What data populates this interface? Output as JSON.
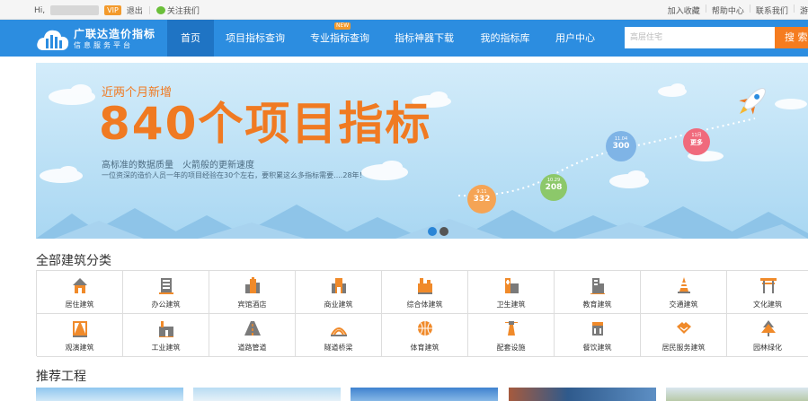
{
  "topbar": {
    "greeting": "Hi,",
    "vip_badge": "VIP",
    "logout": "退出",
    "follow": "关注我们",
    "links": [
      "加入收藏",
      "帮助中心",
      "联系我们",
      "游"
    ]
  },
  "nav": {
    "logo_title": "广联达造价指标",
    "logo_sub": "信息服务平台",
    "items": [
      "首页",
      "项目指标查询",
      "专业指标查询",
      "指标神器下载",
      "我的指标库",
      "用户中心"
    ],
    "new_badge": "NEW",
    "search_placeholder": "高层住宅",
    "search_button": "搜 索"
  },
  "banner": {
    "subtitle": "近两个月新增",
    "headline": "840个项目指标",
    "line1": "高标准的数据质量　火箭般的更新速度",
    "line2": "一位资深的造价人员一年的项目经验在30个左右，要积累这么多指标需要....28年！",
    "bubbles": [
      {
        "date": "9.11",
        "value": "332",
        "color": "#f5a455"
      },
      {
        "date": "10.29",
        "value": "208",
        "color": "#8cc86a"
      },
      {
        "date": "11.04",
        "value": "300",
        "color": "#7fb4e6"
      },
      {
        "date": "11月",
        "value": "更多",
        "color": "#f06a7c"
      }
    ],
    "dots": [
      "#2a85d6",
      "#555555"
    ]
  },
  "categories": {
    "title": "全部建筑分类",
    "items": [
      {
        "label": "居住建筑",
        "icon": "house-icon"
      },
      {
        "label": "办公建筑",
        "icon": "office-building-icon"
      },
      {
        "label": "宾馆酒店",
        "icon": "hotel-icon"
      },
      {
        "label": "商业建筑",
        "icon": "commercial-building-icon"
      },
      {
        "label": "综合体建筑",
        "icon": "complex-building-icon"
      },
      {
        "label": "卫生建筑",
        "icon": "hospital-icon"
      },
      {
        "label": "教育建筑",
        "icon": "school-icon"
      },
      {
        "label": "交通建筑",
        "icon": "traffic-cone-icon"
      },
      {
        "label": "文化建筑",
        "icon": "pavilion-icon"
      },
      {
        "label": "观演建筑",
        "icon": "theater-icon"
      },
      {
        "label": "工业建筑",
        "icon": "factory-icon"
      },
      {
        "label": "道路管道",
        "icon": "road-icon"
      },
      {
        "label": "隧道桥梁",
        "icon": "bridge-icon"
      },
      {
        "label": "体育建筑",
        "icon": "basketball-icon"
      },
      {
        "label": "配套设施",
        "icon": "lighthouse-icon"
      },
      {
        "label": "餐饮建筑",
        "icon": "restaurant-icon"
      },
      {
        "label": "居民服务建筑",
        "icon": "handshake-icon"
      },
      {
        "label": "园林绿化",
        "icon": "tree-icon"
      }
    ]
  },
  "recommended": {
    "title": "推荐工程"
  },
  "colors": {
    "nav_blue": "#2c8de0",
    "accent_orange": "#f57c1f",
    "icon_orange": "#f08a2a"
  }
}
